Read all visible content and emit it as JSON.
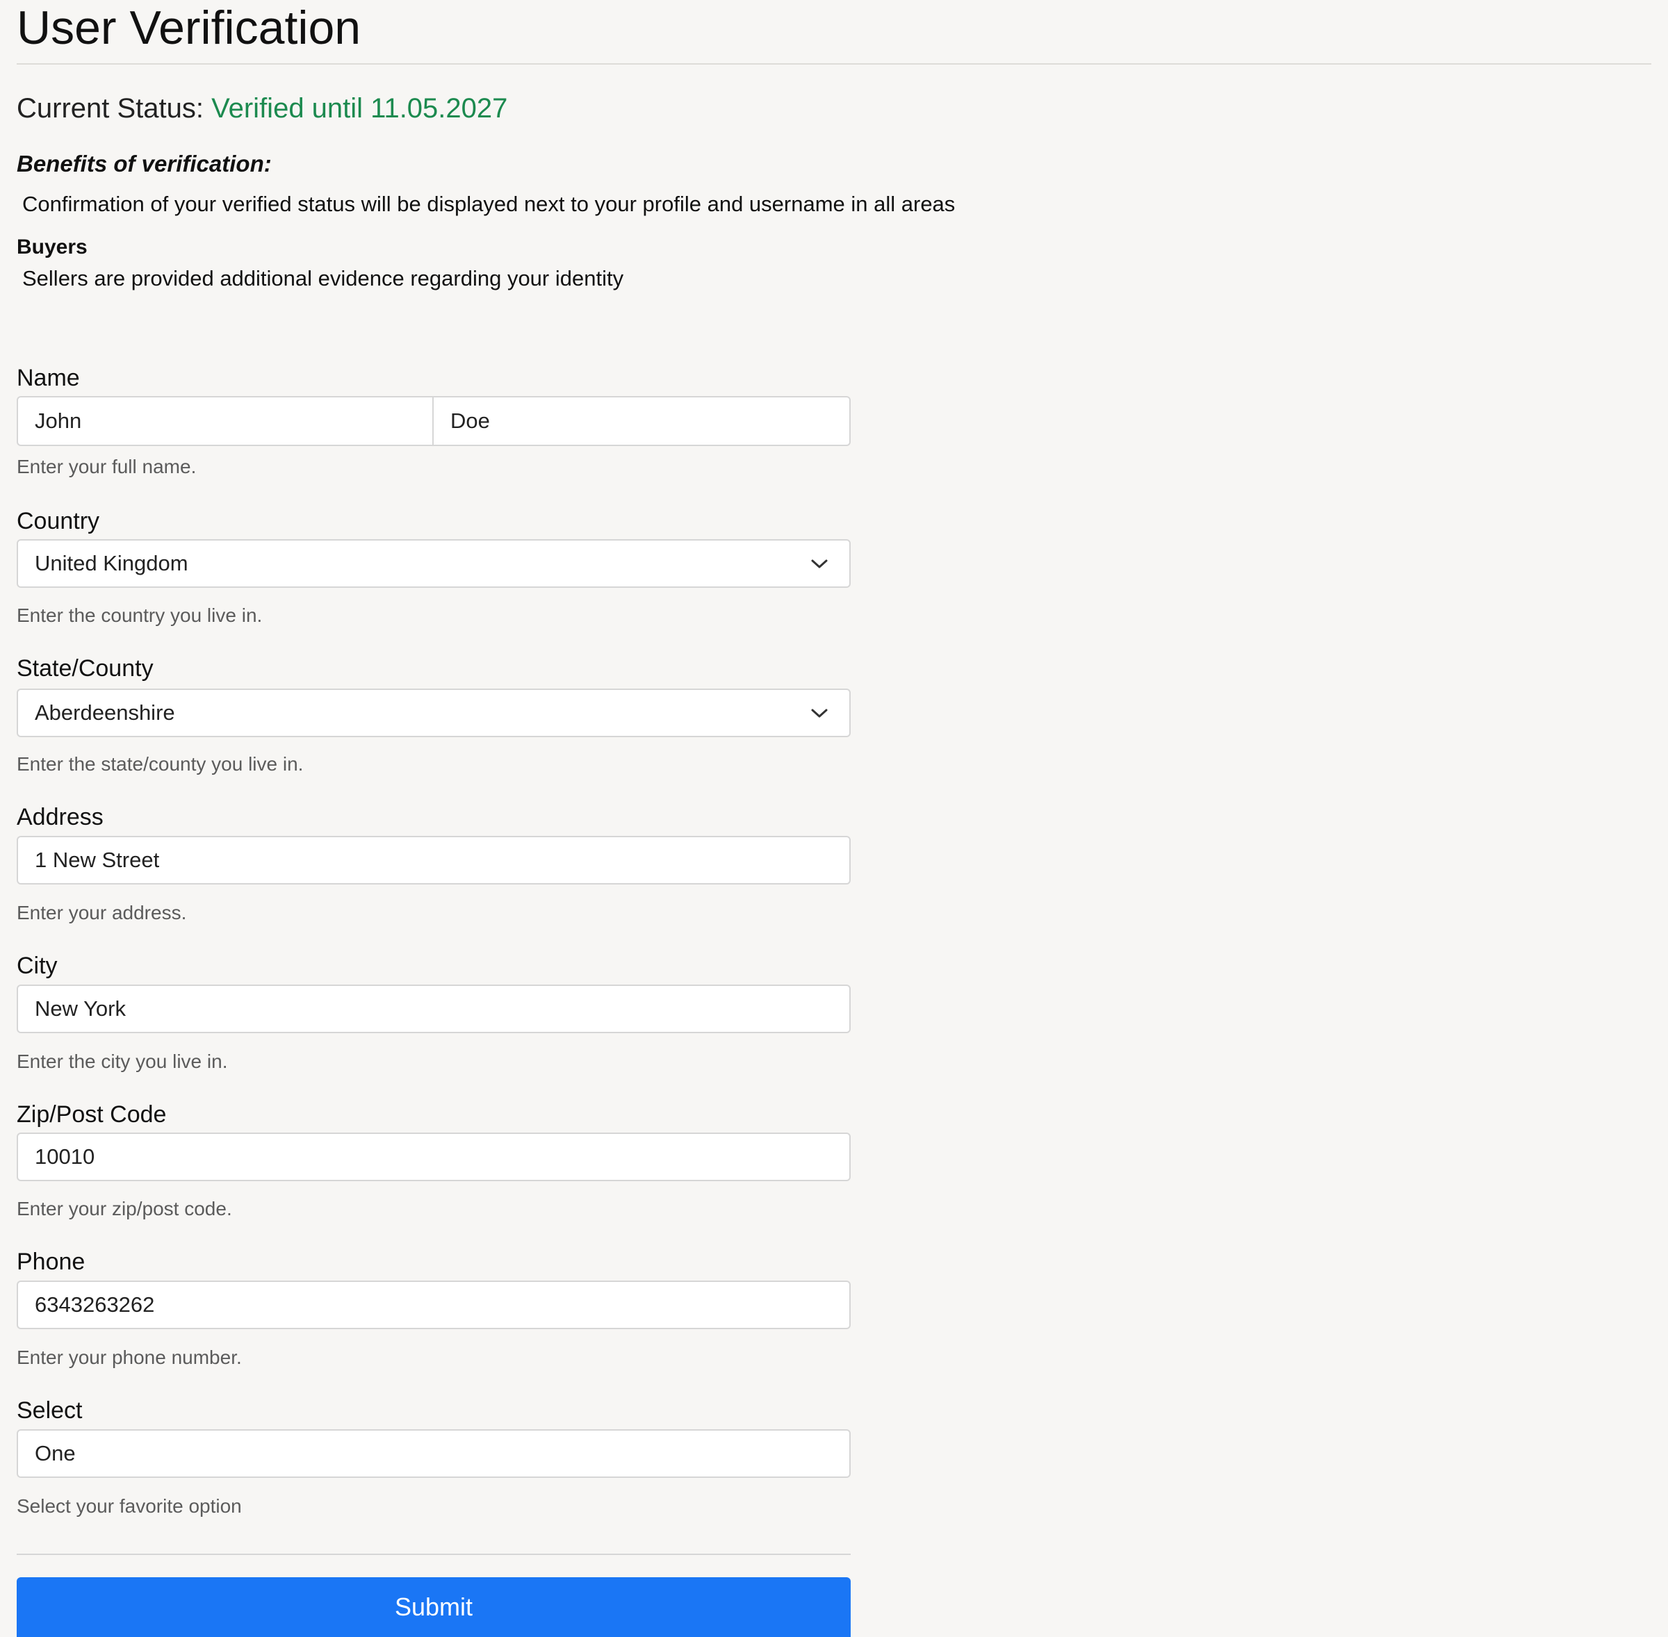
{
  "page": {
    "title": "User Verification"
  },
  "status": {
    "label": "Current Status:",
    "value": "Verified until 11.05.2027",
    "value_color": "#1c8a4f"
  },
  "benefits": {
    "heading": "Benefits of verification:",
    "general": "Confirmation of your verified status will be displayed next to your profile and username in all areas",
    "buyers_heading": "Buyers",
    "buyers": "Sellers are provided additional evidence regarding your identity"
  },
  "form": {
    "name": {
      "label": "Name",
      "first": "John",
      "last": "Doe",
      "help": "Enter your full name."
    },
    "country": {
      "label": "Country",
      "value": "United Kingdom",
      "help": "Enter the country you live in."
    },
    "state": {
      "label": "State/County",
      "value": "Aberdeenshire",
      "help": "Enter the state/county you live in."
    },
    "address": {
      "label": "Address",
      "value": "1 New Street",
      "help": "Enter your address."
    },
    "city": {
      "label": "City",
      "value": "New York",
      "help": "Enter the city you live in."
    },
    "zip": {
      "label": "Zip/Post Code",
      "value": "10010",
      "help": "Enter your zip/post code."
    },
    "phone": {
      "label": "Phone",
      "value": "6343263262",
      "help": "Enter your phone number."
    },
    "select": {
      "label": "Select",
      "value": "One",
      "help": "Select your favorite option"
    },
    "submit_label": "Submit",
    "submit_color": "#1a76f5"
  }
}
